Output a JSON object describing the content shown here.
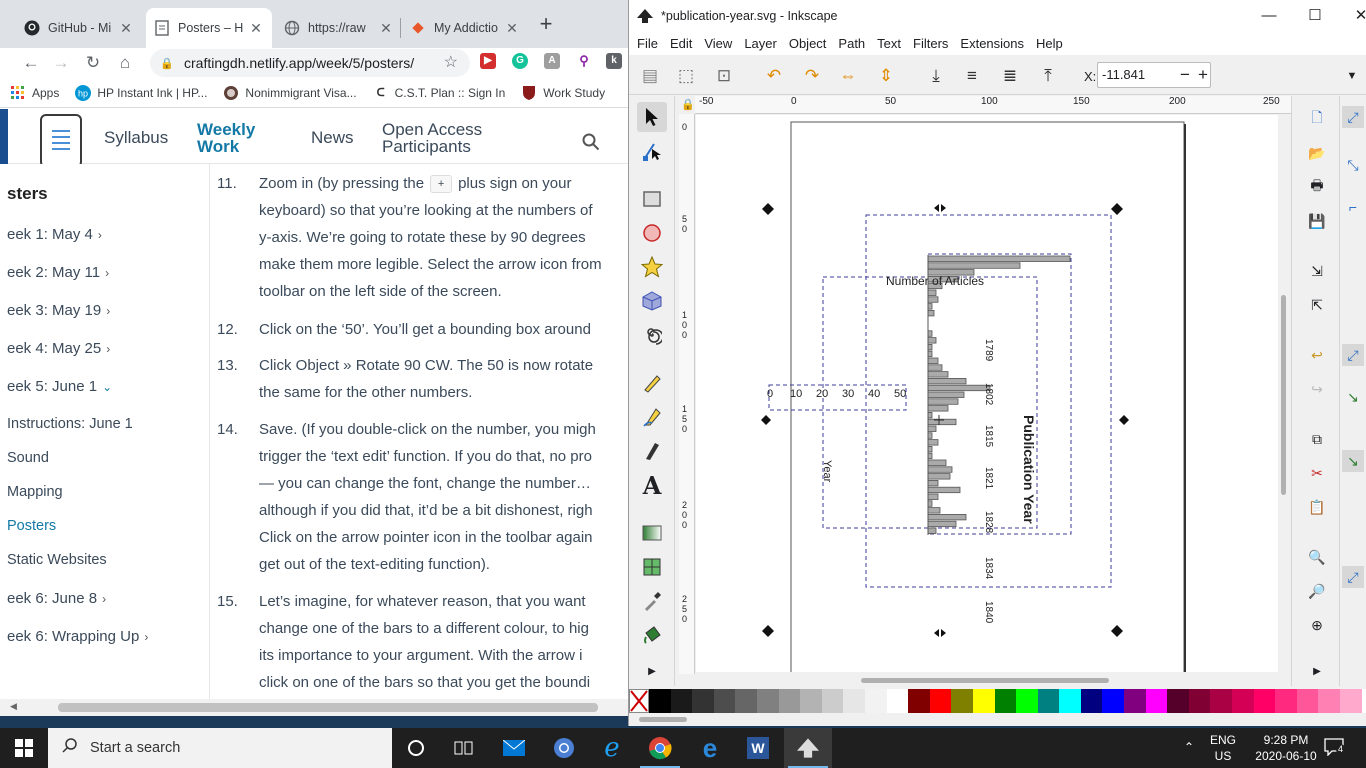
{
  "browser": {
    "tabs": [
      {
        "title": "GitHub - Mi",
        "icon": "github-icon",
        "active": false
      },
      {
        "title": "Posters – H",
        "icon": "document-icon",
        "active": true
      },
      {
        "title": "https://raw",
        "icon": "globe-icon",
        "active": false
      },
      {
        "title": "My Addictio",
        "icon": "diamond-icon",
        "active": false
      }
    ],
    "new_tab": "+",
    "url": "craftingdh.netlify.app/week/5/posters/",
    "bookmarks": [
      {
        "label": "Apps",
        "icon": "apps-grid-icon"
      },
      {
        "label": "HP Instant Ink | HP...",
        "icon": "hp-logo-icon"
      },
      {
        "label": "Nonimmigrant Visa...",
        "icon": "seal-icon"
      },
      {
        "label": "C.S.T. Plan :: Sign In",
        "icon": "cst-logo-icon"
      },
      {
        "label": "Work Study",
        "icon": "shield-logo-icon"
      }
    ]
  },
  "site": {
    "nav": {
      "syllabus": "Syllabus",
      "weekly": "Weekly Work",
      "weekly_l1": "Weekly",
      "weekly_l2": "Work",
      "news": "News",
      "open_l1": "Open Access",
      "open_l2": "Participants"
    },
    "sidebar": {
      "title": "sters",
      "items": [
        {
          "label": "eek 1: May 4",
          "chev": "›"
        },
        {
          "label": "eek 2: May 11",
          "chev": "›"
        },
        {
          "label": "eek 3: May 19",
          "chev": "›"
        },
        {
          "label": "eek 4: May 25",
          "chev": "›"
        },
        {
          "label": "eek 5: June 1",
          "chev": "⌄"
        },
        {
          "label": "Instructions: June 1"
        },
        {
          "label": "Sound"
        },
        {
          "label": "Mapping"
        },
        {
          "label": "Posters"
        },
        {
          "label": "Static Websites"
        },
        {
          "label": "eek 6: June 8",
          "chev": "›"
        },
        {
          "label": "eek 6: Wrapping Up",
          "chev": "›"
        }
      ]
    },
    "steps": [
      {
        "num": "11.",
        "lines": [
          "Zoom in (by pressing the",
          "keyboard) so that you’re looking at the numbers of",
          "y-axis. We’re going to rotate these by 90 degrees",
          "make them more legible. Select the arrow icon from",
          "toolbar on the left side of the screen."
        ],
        "kbd": "+",
        "after_kbd": "plus sign on your"
      },
      {
        "num": "12.",
        "lines": [
          "Click on the ‘50’. You’ll get a bounding box around"
        ]
      },
      {
        "num": "13.",
        "lines": [
          "Click Object » Rotate 90 CW. The 50 is now rotate",
          "the same for the other numbers."
        ]
      },
      {
        "num": "14.",
        "lines": [
          "Save. (If you double-click on the number, you migh",
          "trigger the ‘text edit’ function. If you do that, no pro",
          "— you can change the font, change the number…",
          "although if you did that, it’d be a bit dishonest, righ",
          "Click on the arrow pointer icon in the toolbar again",
          "get out of the text-editing function)."
        ]
      },
      {
        "num": "15.",
        "lines": [
          "Let’s imagine, for whatever reason, that you want",
          "change one of the bars to a different colour, to hig",
          "its importance to your argument. With the arrow i",
          "click on one of the bars so that you get the boundi"
        ]
      }
    ]
  },
  "inkscape": {
    "title": "*publication-year.svg - Inkscape",
    "menu": [
      "File",
      "Edit",
      "View",
      "Layer",
      "Object",
      "Path",
      "Text",
      "Filters",
      "Extensions",
      "Help"
    ],
    "x_label": "X:",
    "x_value": "-11.841",
    "ruler_top": [
      "-50",
      "0",
      "50",
      "100",
      "150",
      "200",
      "250"
    ],
    "ruler_left": [
      "0",
      "5 0",
      "1 0 0",
      "1 5 0",
      "2 0 0",
      "2 5 0"
    ],
    "drawing": {
      "label_articles": "Number of Articles",
      "label_pub_year": "Publication Year",
      "label_year": "Year",
      "x_ticks": [
        "0",
        "10",
        "20",
        "30",
        "40",
        "50"
      ],
      "year_ticks": [
        "1789",
        "1802",
        "1815",
        "1821",
        "1828",
        "1834",
        "1840"
      ]
    },
    "palette": [
      "#000000",
      "#1a1a1a",
      "#333333",
      "#4d4d4d",
      "#666666",
      "#808080",
      "#999999",
      "#b3b3b3",
      "#cccccc",
      "#e6e6e6",
      "#f2f2f2",
      "#ffffff",
      "#800000",
      "#ff0000",
      "#808000",
      "#ffff00",
      "#008000",
      "#00ff00",
      "#008080",
      "#00ffff",
      "#000080",
      "#0000ff",
      "#800080",
      "#ff00ff",
      "#55002b",
      "#800033",
      "#aa0044",
      "#d40055",
      "#ff0066",
      "#ff2a7f",
      "#ff5599",
      "#ff80b2",
      "#ffaacc"
    ]
  },
  "taskbar": {
    "search": "Start a search",
    "lang1": "ENG",
    "lang2": "US",
    "time": "9:28 PM",
    "date": "2020-06-10",
    "notif": "4"
  }
}
